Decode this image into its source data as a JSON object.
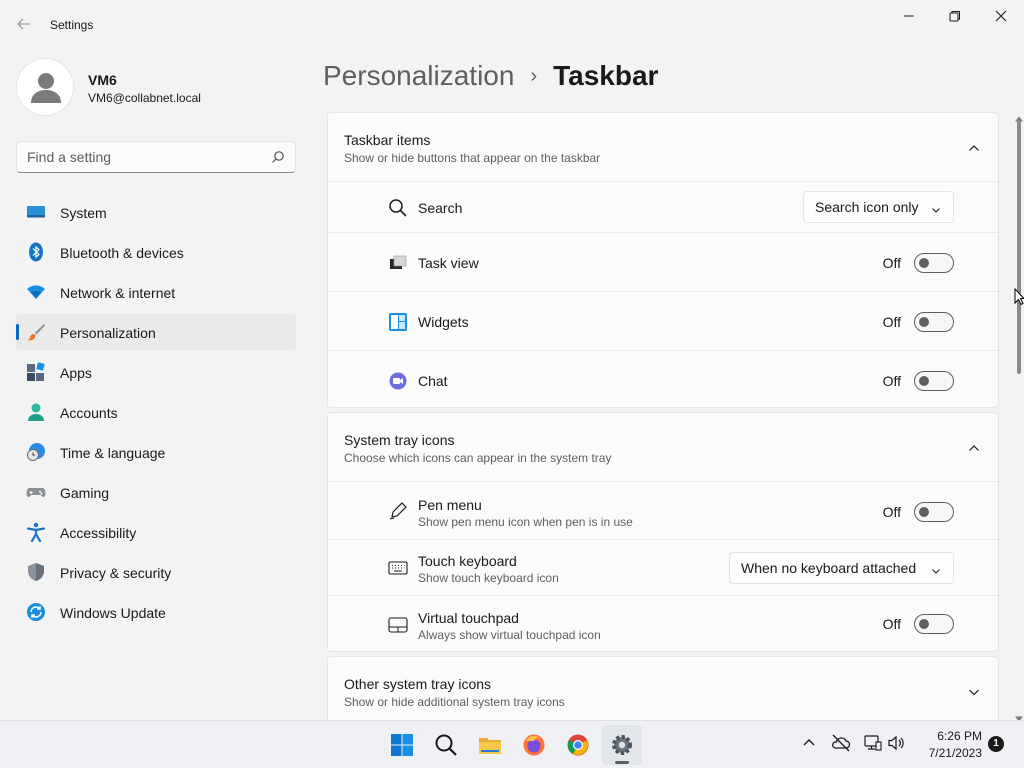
{
  "app": {
    "title": "Settings"
  },
  "user": {
    "name": "VM6",
    "email": "VM6@collabnet.local"
  },
  "search": {
    "placeholder": "Find a setting"
  },
  "nav": [
    {
      "label": "System",
      "icon": "system-icon",
      "selected": false
    },
    {
      "label": "Bluetooth & devices",
      "icon": "bluetooth-icon",
      "selected": false
    },
    {
      "label": "Network & internet",
      "icon": "wifi-icon",
      "selected": false
    },
    {
      "label": "Personalization",
      "icon": "brush-icon",
      "selected": true
    },
    {
      "label": "Apps",
      "icon": "apps-icon",
      "selected": false
    },
    {
      "label": "Accounts",
      "icon": "accounts-icon",
      "selected": false
    },
    {
      "label": "Time & language",
      "icon": "globe-clock-icon",
      "selected": false
    },
    {
      "label": "Gaming",
      "icon": "gamepad-icon",
      "selected": false
    },
    {
      "label": "Accessibility",
      "icon": "accessibility-icon",
      "selected": false
    },
    {
      "label": "Privacy & security",
      "icon": "shield-icon",
      "selected": false
    },
    {
      "label": "Windows Update",
      "icon": "update-icon",
      "selected": false
    }
  ],
  "breadcrumb": {
    "parent": "Personalization",
    "separator": "›",
    "current": "Taskbar"
  },
  "taskbar_items": {
    "title": "Taskbar items",
    "subtitle": "Show or hide buttons that appear on the taskbar",
    "search": {
      "label": "Search",
      "value": "Search icon only"
    },
    "task_view": {
      "label": "Task view",
      "state": "Off"
    },
    "widgets": {
      "label": "Widgets",
      "state": "Off"
    },
    "chat": {
      "label": "Chat",
      "state": "Off"
    }
  },
  "system_tray": {
    "title": "System tray icons",
    "subtitle": "Choose which icons can appear in the system tray",
    "pen_menu": {
      "label": "Pen menu",
      "sub": "Show pen menu icon when pen is in use",
      "state": "Off"
    },
    "touch_keyboard": {
      "label": "Touch keyboard",
      "sub": "Show touch keyboard icon",
      "value": "When no keyboard attached"
    },
    "virtual_touchpad": {
      "label": "Virtual touchpad",
      "sub": "Always show virtual touchpad icon",
      "state": "Off"
    }
  },
  "other_tray": {
    "title": "Other system tray icons",
    "subtitle": "Show or hide additional system tray icons"
  },
  "clock": {
    "time": "6:26 PM",
    "date": "7/21/2023"
  },
  "notifications": {
    "count": "1"
  },
  "colors": {
    "accent": "#0067c0",
    "background": "#f3f3f3",
    "card": "#fbfbfb"
  }
}
